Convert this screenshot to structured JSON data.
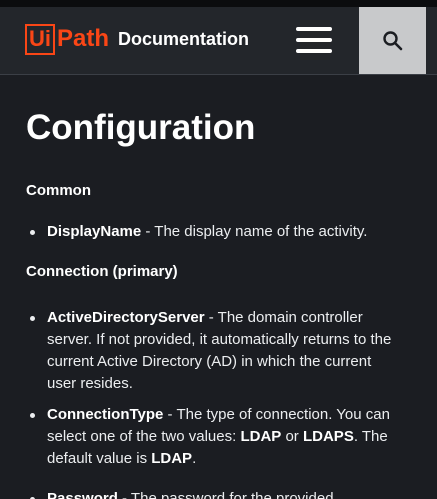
{
  "header": {
    "logo_ui": "Ui",
    "logo_path": "Path",
    "logo_doc": "Documentation",
    "menu_icon": "hamburger-menu-icon",
    "search_icon": "search-icon",
    "brand_color": "#fa4616"
  },
  "page": {
    "title": "Configuration"
  },
  "sections": {
    "common": {
      "heading": "Common",
      "items": [
        {
          "name": "DisplayName",
          "desc": " - The display name of the activity."
        }
      ]
    },
    "connection": {
      "heading": "Connection (primary)",
      "items": [
        {
          "name": "ActiveDirectoryServer",
          "desc": " - The domain controller server. If not provided, it automatically returns to the current Active Directory (AD) in which the current user resides."
        },
        {
          "name": "ConnectionType",
          "desc1": " - The type of connection. You can select one of the two values: ",
          "v1": "LDAP",
          "or": " or ",
          "v2": "LDAPS",
          "desc2": ". The default value is ",
          "v3": "LDAP",
          "end": "."
        },
        {
          "name": "Password",
          "desc": " - The password for the provided"
        }
      ]
    }
  }
}
